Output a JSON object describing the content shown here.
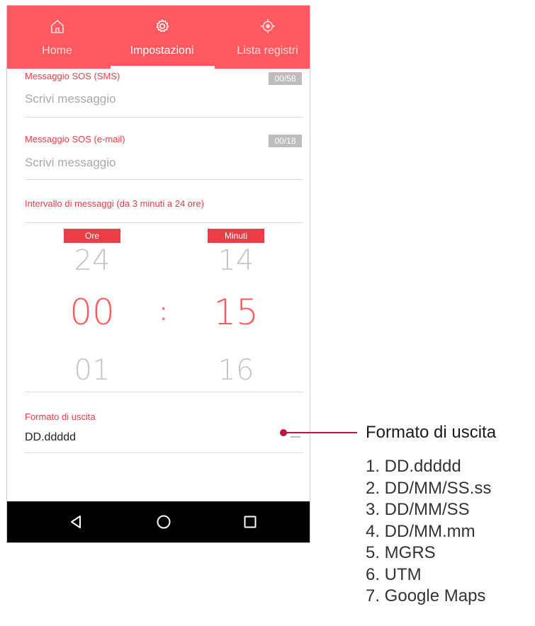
{
  "tabs": [
    {
      "label": "Home",
      "icon": "home-icon",
      "active": false
    },
    {
      "label": "Impostazioni",
      "icon": "gear-icon",
      "active": true
    },
    {
      "label": "Lista registri",
      "icon": "location-target-icon",
      "active": false
    }
  ],
  "sos_sms": {
    "label": "Messaggio SOS (SMS)",
    "counter": "00/58",
    "placeholder": "Scrivi messaggio"
  },
  "sos_email": {
    "label": "Messaggio SOS (e-mail)",
    "counter": "00/18",
    "placeholder": "Scrivi messaggio"
  },
  "interval": {
    "label": "Intervallo di messaggi (da 3 minuti a 24 ore)",
    "hours": {
      "label": "Ore",
      "prev": "24",
      "selected": "00",
      "next": "01"
    },
    "separator": ":",
    "minutes": {
      "label": "Minuti",
      "prev": "14",
      "selected": "15",
      "next": "16"
    }
  },
  "output_format": {
    "label": "Formato di uscita",
    "value": "DD.ddddd"
  },
  "nav": [
    "back-icon",
    "home-circle-icon",
    "recents-square-icon"
  ],
  "legend": {
    "title": "Formato di uscita",
    "items": [
      "1. DD.ddddd",
      "2. DD/MM/SS.ss",
      "3. DD/MM/SS",
      "4. DD/MM.mm",
      "5. MGRS",
      "6. UTM",
      "7. Google Maps"
    ]
  },
  "colors": {
    "accent": "#ff5a5f",
    "label_red": "#ee3d46",
    "callout": "#b81a3f",
    "navbar": "#000000"
  }
}
